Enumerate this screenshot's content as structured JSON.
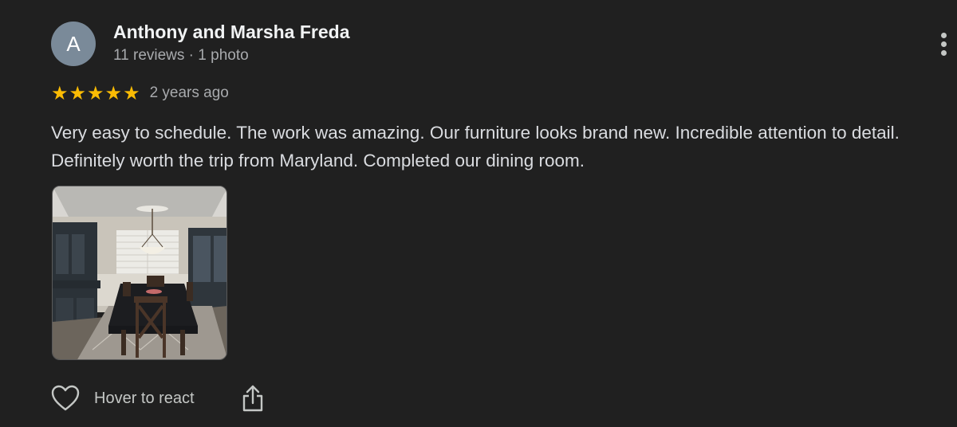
{
  "review": {
    "avatar_letter": "A",
    "reviewer_name": "Anthony and Marsha Freda",
    "reviewer_meta": "11 reviews · 1 photo",
    "rating": 5,
    "rating_stars": "★★★★★",
    "date": "2 years ago",
    "text": "Very easy to schedule. The work was amazing. Our furniture looks brand new. Incredible attention to detail. Definitely worth the trip from Maryland. Completed our dining room.",
    "photo_count": 1
  },
  "actions": {
    "react_label": "Hover to react",
    "react_icon": "heart-outline-icon",
    "share_icon": "share-icon",
    "more_icon": "more-vertical-icon"
  },
  "colors": {
    "background": "#202020",
    "star": "#fbbc04",
    "avatar_bg": "#7a8a99"
  }
}
